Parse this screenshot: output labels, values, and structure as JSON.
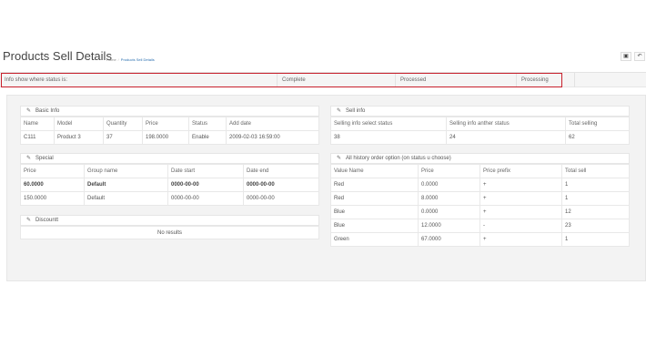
{
  "header": {
    "title": "Products Sell Details",
    "breadcrumb": [
      "Home",
      "Products Sell Details"
    ],
    "buttons": [
      {
        "name": "settings",
        "icon": "square-icon",
        "glyph": "▣"
      },
      {
        "name": "back",
        "icon": "back-arrow-icon",
        "glyph": "↶"
      }
    ]
  },
  "status_bar": {
    "label": "Info show where status is:",
    "statuses": [
      "Complete",
      "Processed",
      "Processing"
    ],
    "highlight_color": "#c8202c"
  },
  "basic_info": {
    "title": "Basic Info",
    "columns": [
      "Name",
      "Model",
      "Quantity",
      "Price",
      "Status",
      "Add date"
    ],
    "rows": [
      [
        "C111",
        "Product 3",
        "37",
        "198.0000",
        "Enable",
        "2009-02-03 16:59:00"
      ]
    ]
  },
  "sell_info": {
    "title": "Sell info",
    "columns": [
      "Selling info select status",
      "Selling info anther status",
      "Total selling"
    ],
    "rows": [
      [
        "38",
        "24",
        "62"
      ]
    ]
  },
  "special": {
    "title": "Special",
    "columns": [
      "Price",
      "Group name",
      "Date start",
      "Date end"
    ],
    "rows": [
      [
        "60.0000",
        "Default",
        "0000-00-00",
        "0000-00-00"
      ],
      [
        "150.0000",
        "Default",
        "0000-00-00",
        "0000-00-00"
      ]
    ]
  },
  "history": {
    "title": "All history order option (on status u choose)",
    "columns": [
      "Value Name",
      "Price",
      "Price prefix",
      "Total sell"
    ],
    "rows": [
      [
        "Red",
        "0.0000",
        "+",
        "1"
      ],
      [
        "Red",
        "8.0000",
        "+",
        "1"
      ],
      [
        "Blue",
        "0.0000",
        "+",
        "12"
      ],
      [
        "Blue",
        "12.0000",
        "-",
        "23"
      ],
      [
        "Green",
        "67.0000",
        "+",
        "1"
      ]
    ]
  },
  "discount": {
    "title": "Discountt",
    "empty_text": "No results"
  }
}
